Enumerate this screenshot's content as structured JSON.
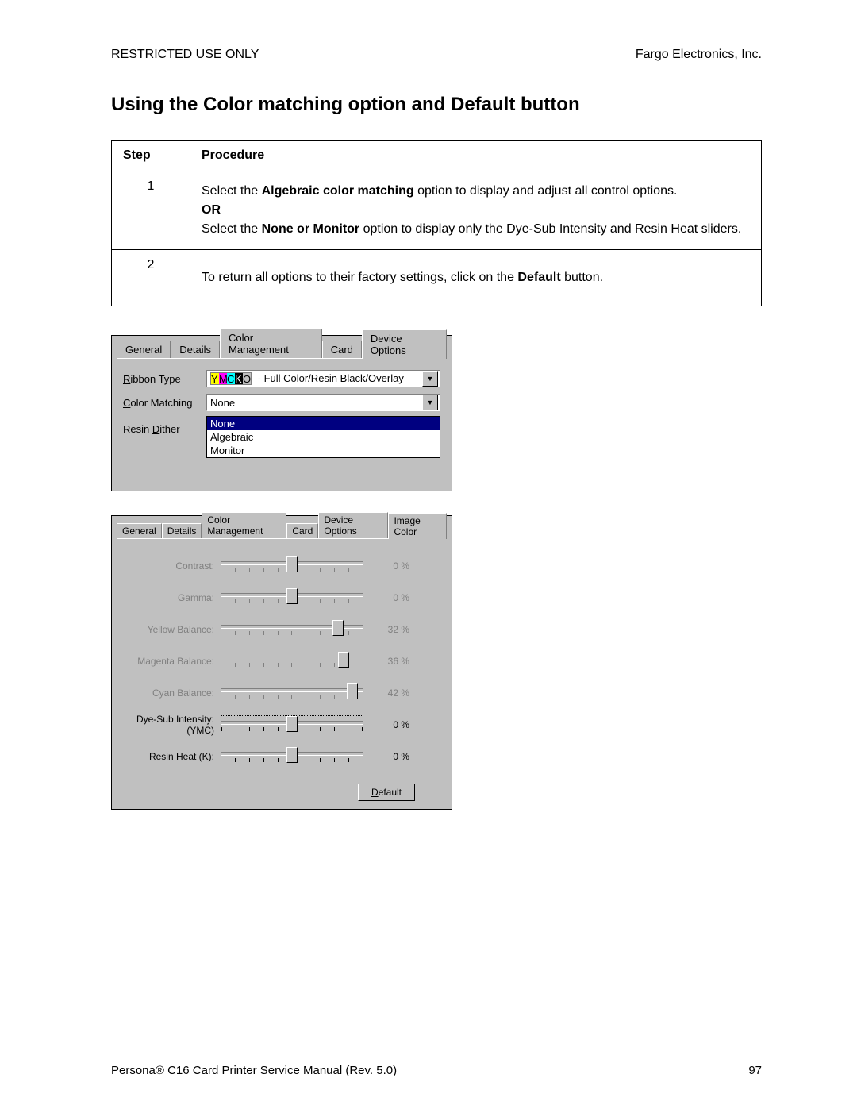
{
  "header": {
    "left": "RESTRICTED USE ONLY",
    "right": "Fargo Electronics, Inc."
  },
  "title": "Using the Color matching option and Default button",
  "table": {
    "head": {
      "step": "Step",
      "proc": "Procedure"
    },
    "rows": [
      {
        "step": "1",
        "p1a": "Select the ",
        "p1b": "Algebraic color matching",
        "p1c": " option to display and adjust all control options.",
        "or": "OR",
        "p2a": "Select the ",
        "p2b": "None or Monitor",
        "p2c": " option to display only the Dye-Sub Intensity and Resin Heat sliders."
      },
      {
        "step": "2",
        "p1a": "To return all options to their factory settings, click on the ",
        "p1b": "Default",
        "p1c": " button."
      }
    ]
  },
  "ss1": {
    "tabs": [
      "General",
      "Details",
      "Color Management",
      "Card",
      "Device Options"
    ],
    "active_tab": "Device Options",
    "ribbon_label": "Ribbon Type",
    "ribbon_text": " - Full Color/Resin Black/Overlay",
    "ymcko": [
      "Y",
      "M",
      "C",
      "K",
      "O"
    ],
    "matching_label": "Color Matching",
    "matching_value": "None",
    "options": [
      "None",
      "Algebraic",
      "Monitor"
    ],
    "dither_label": "Resin Dither"
  },
  "ss2": {
    "tabs": [
      "General",
      "Details",
      "Color Management",
      "Card",
      "Device Options",
      "Image Color"
    ],
    "active_tab": "Image Color",
    "sliders": [
      {
        "label": "Contrast:",
        "value": 0,
        "display": "0  %",
        "enabled": false,
        "pos": 50
      },
      {
        "label": "Gamma:",
        "value": 0,
        "display": "0  %",
        "enabled": false,
        "pos": 50
      },
      {
        "label": "Yellow Balance:",
        "value": 32,
        "display": "32  %",
        "enabled": false,
        "pos": 82
      },
      {
        "label": "Magenta Balance:",
        "value": 36,
        "display": "36  %",
        "enabled": false,
        "pos": 86
      },
      {
        "label": "Cyan Balance:",
        "value": 42,
        "display": "42  %",
        "enabled": false,
        "pos": 92
      },
      {
        "label": "Dye-Sub Intensity:\n(YMC)",
        "value": 0,
        "display": "0  %",
        "enabled": true,
        "pos": 50,
        "boxed": true
      },
      {
        "label": "Resin Heat  (K):",
        "value": 0,
        "display": "0  %",
        "enabled": true,
        "pos": 50
      }
    ],
    "default_btn": "Default"
  },
  "footer": {
    "left": "Persona® C16 Card Printer Service Manual (Rev. 5.0)",
    "right": "97"
  }
}
